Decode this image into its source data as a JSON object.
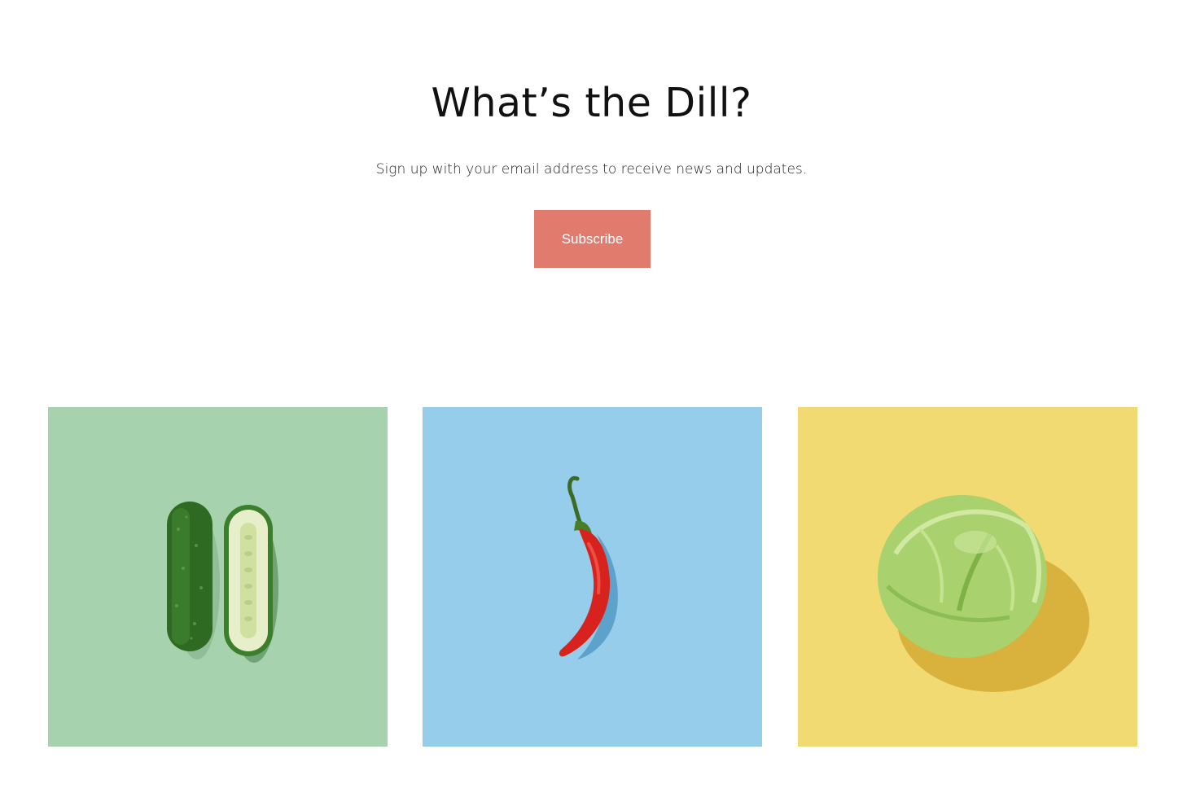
{
  "newsletter": {
    "title": "What’s the Dill?",
    "subtitle": "Sign up with your email address to receive news and updates.",
    "subscribe_label": "Subscribe",
    "accent_color": "#e07b6e"
  },
  "gallery": {
    "tiles": [
      {
        "subject": "cucumber",
        "background": "#a7d2ae"
      },
      {
        "subject": "red-chili-pepper",
        "background": "#95cdea"
      },
      {
        "subject": "cabbage",
        "background": "#f1da71"
      }
    ]
  }
}
